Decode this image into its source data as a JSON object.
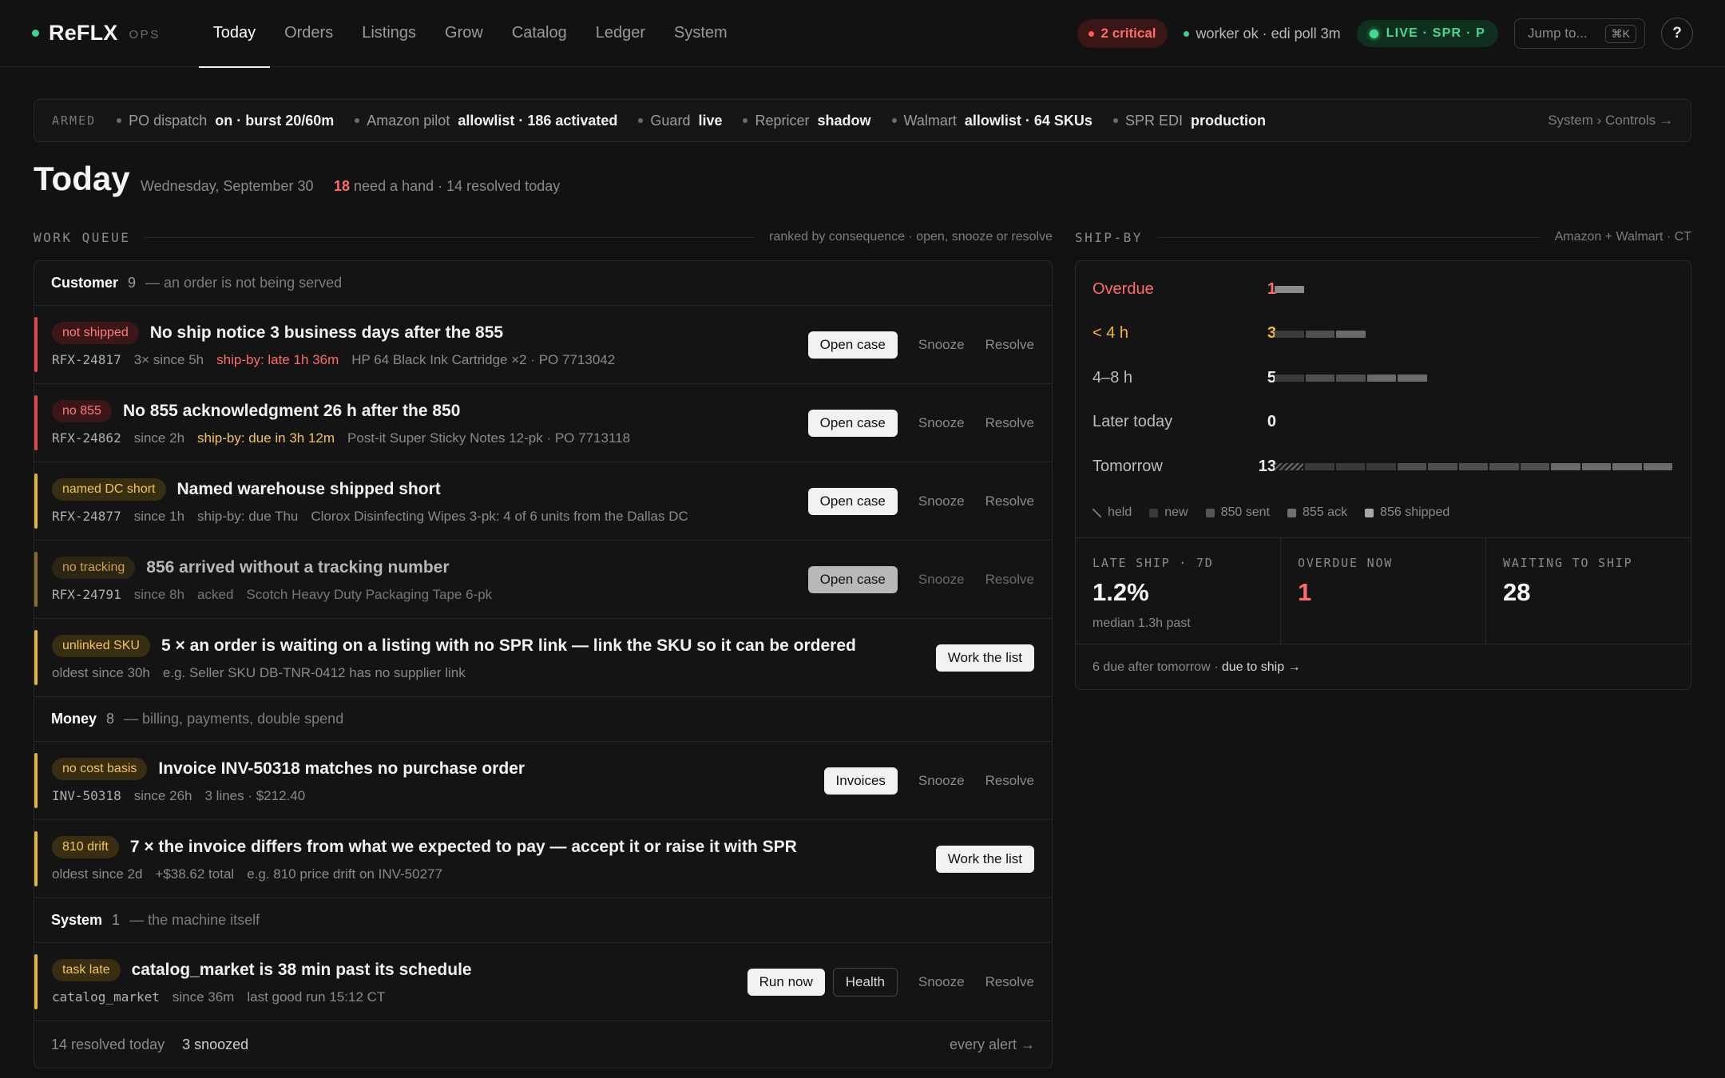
{
  "brand": {
    "name": "ReFLX",
    "sub": "OPS"
  },
  "nav": [
    "Today",
    "Orders",
    "Listings",
    "Grow",
    "Catalog",
    "Ledger",
    "System"
  ],
  "top": {
    "critical": "2 critical",
    "worker": "worker ok · edi poll 3m",
    "live": "LIVE · SPR · P",
    "jump_placeholder": "Jump to...",
    "jump_kbd": "⌘K",
    "help": "?"
  },
  "armed": {
    "label": "ARMED",
    "items": [
      {
        "key": "PO dispatch",
        "val": "on · burst 20/60m"
      },
      {
        "key": "Amazon pilot",
        "val": "allowlist · 186 activated"
      },
      {
        "key": "Guard",
        "val": "live"
      },
      {
        "key": "Repricer",
        "val": "shadow"
      },
      {
        "key": "Walmart",
        "val": "allowlist · 64 SKUs"
      },
      {
        "key": "SPR EDI",
        "val": "production"
      }
    ],
    "link": "System › Controls →"
  },
  "page": {
    "title": "Today",
    "date": "Wednesday, September 30",
    "need_count": "18",
    "need_text": " need a hand · 14 resolved today"
  },
  "queue": {
    "label": "WORK QUEUE",
    "note": "ranked by consequence · open, snooze or resolve",
    "groups": [
      {
        "name": "Customer",
        "count": "9",
        "desc": "— an order is not being served"
      },
      {
        "name": "Money",
        "count": "8",
        "desc": "— billing, payments, double spend"
      },
      {
        "name": "System",
        "count": "1",
        "desc": "— the machine itself"
      }
    ],
    "rows": [
      {
        "tag": "not shipped",
        "title": "No ship notice 3 business days after the 855",
        "id": "RFX-24817",
        "since": "3× since 5h",
        "ship": "ship-by: late 1h 36m",
        "detail": "HP 64 Black Ink Cartridge ×2 · PO 7713042",
        "action": "Open case"
      },
      {
        "tag": "no 855",
        "title": "No 855 acknowledgment 26 h after the 850",
        "id": "RFX-24862",
        "since": "since 2h",
        "ship": "ship-by: due in 3h 12m",
        "detail": "Post-it Super Sticky Notes 12-pk · PO 7713118",
        "action": "Open case"
      },
      {
        "tag": "named DC short",
        "title": "Named warehouse shipped short",
        "id": "RFX-24877",
        "since": "since 1h",
        "ship": "ship-by: due Thu",
        "detail": "Clorox Disinfecting Wipes 3-pk: 4 of 6 units from the Dallas DC",
        "action": "Open case"
      },
      {
        "tag": "no tracking",
        "title": "856 arrived without a tracking number",
        "id": "RFX-24791",
        "since": "since 8h",
        "ship": "acked",
        "detail": "Scotch Heavy Duty Packaging Tape 6-pk",
        "action": "Open case"
      },
      {
        "tag": "unlinked SKU",
        "title": "5 × an order is waiting on a listing with no SPR link — link the SKU so it can be ordered",
        "since": "oldest since 30h",
        "detail": "e.g. Seller SKU DB-TNR-0412 has no supplier link",
        "action": "Work the list"
      },
      {
        "tag": "no cost basis",
        "title": "Invoice INV-50318 matches no purchase order",
        "id": "INV-50318",
        "since": "since 26h",
        "detail": "3 lines · $212.40",
        "action": "Invoices"
      },
      {
        "tag": "810 drift",
        "title": "7 × the invoice differs from what we expected to pay — accept it or raise it with SPR",
        "since": "oldest since 2d",
        "extra": "+$38.62 total",
        "detail": "e.g. 810 price drift on INV-50277",
        "action": "Work the list"
      },
      {
        "tag": "task late",
        "title": "catalog_market is 38 min past its schedule",
        "id": "catalog_market",
        "since": "since 36m",
        "detail": "last good run 15:12 CT",
        "action": "Run now",
        "action2": "Health"
      }
    ],
    "snooze": "Snooze",
    "resolve": "Resolve",
    "foot": {
      "resolved": "14 resolved today",
      "snoozed": "3 snoozed",
      "link": "every alert →"
    }
  },
  "shipby": {
    "label": "SHIP-BY",
    "note": "Amazon + Walmart · CT",
    "rows": [
      {
        "label": "Overdue",
        "count": "1",
        "segments": [
          0,
          1,
          0,
          0,
          0
        ]
      },
      {
        "label": "< 4 h",
        "count": "3",
        "segments": [
          0,
          1,
          1,
          1,
          0
        ]
      },
      {
        "label": "4–8 h",
        "count": "5",
        "segments": [
          0,
          1,
          2,
          2,
          0
        ]
      },
      {
        "label": "Later today",
        "count": "0",
        "segments": [
          0,
          0,
          0,
          0,
          0
        ]
      },
      {
        "label": "Tomorrow",
        "count": "13",
        "segments": [
          1,
          3,
          5,
          4,
          0
        ]
      }
    ],
    "legend": [
      "held",
      "new",
      "850 sent",
      "855 ack",
      "856 shipped"
    ],
    "stats": [
      {
        "label": "LATE SHIP · 7D",
        "value": "1.2%",
        "sub": "median 1.3h past"
      },
      {
        "label": "OVERDUE NOW",
        "value": "1",
        "sub": ""
      },
      {
        "label": "WAITING TO SHIP",
        "value": "28",
        "sub": ""
      }
    ],
    "foot_text": "6 due after tomorrow · ",
    "foot_link": "due to ship →",
    "colors": {
      "overdue": "#ff6b6b",
      "soon": "#f5b731",
      "new": "#3a3a3a",
      "sent": "#4f4f4f",
      "ack": "#6a6a6a",
      "shipped": "#a8a8a8"
    }
  }
}
